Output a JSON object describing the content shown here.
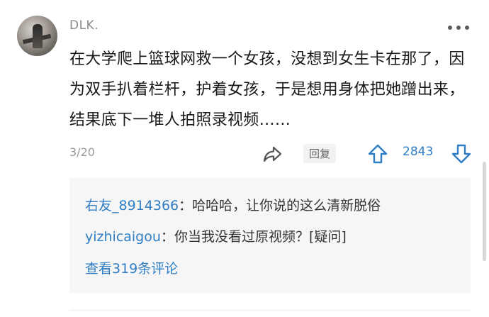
{
  "comment": {
    "username": "DLK.",
    "text": "在大学爬上篮球网救一个女孩，没想到女生卡在那了，因为双手扒着栏杆，护着女孩，于是想用身体把她蹭出来，结果底下一堆人拍照录视频……",
    "page_indicator": "3/20",
    "reply_label": "回复",
    "vote_count": "2843"
  },
  "replies": {
    "items": [
      {
        "user": "右友_8914366",
        "separator": "：",
        "text": "哈哈哈，让你说的这么清新脱俗"
      },
      {
        "user": "yizhicaigou",
        "separator": "：",
        "text": "你当我没看过原视频？[疑问]"
      }
    ],
    "view_all_label": "查看319条评论"
  },
  "colors": {
    "accent": "#2f7ec5",
    "muted": "#9a9a9a",
    "reply_bg": "#f6f6f6"
  },
  "icons": {
    "more": "more-icon",
    "share": "share-icon",
    "upvote": "upvote-icon",
    "downvote": "downvote-icon"
  }
}
